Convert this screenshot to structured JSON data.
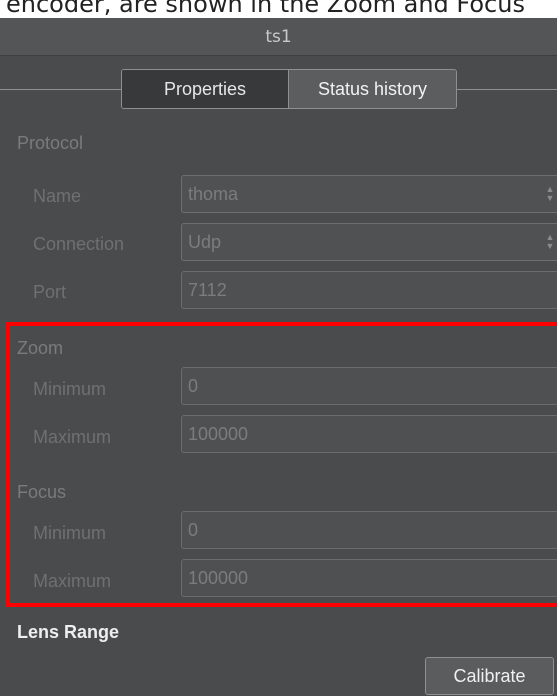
{
  "caption_fragment": "encoder, are shown in the Zoom and Focus",
  "window": {
    "title": "ts1"
  },
  "tabs": [
    {
      "label": "Properties",
      "active": true
    },
    {
      "label": "Status history",
      "active": false
    }
  ],
  "protocol": {
    "heading": "Protocol",
    "name_label": "Name",
    "name_value": "thoma",
    "connection_label": "Connection",
    "connection_value": "Udp",
    "port_label": "Port",
    "port_value": "7112"
  },
  "zoom": {
    "heading": "Zoom",
    "minimum_label": "Minimum",
    "minimum_value": "0",
    "maximum_label": "Maximum",
    "maximum_value": "100000"
  },
  "focus": {
    "heading": "Focus",
    "minimum_label": "Minimum",
    "minimum_value": "0",
    "maximum_label": "Maximum",
    "maximum_value": "100000"
  },
  "lens_range": {
    "heading": "Lens Range",
    "calibrate_label": "Calibrate"
  },
  "colors": {
    "panel_bg": "#4a4b4d",
    "highlight": "#ff0000",
    "field_border": "#6a6b6d"
  }
}
